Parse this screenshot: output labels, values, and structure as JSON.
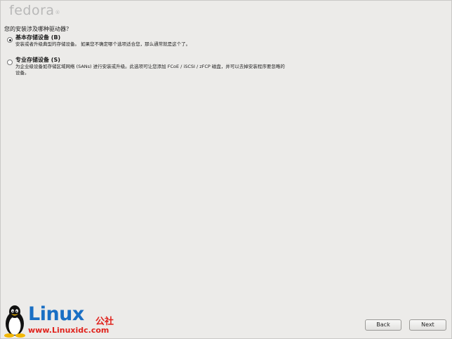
{
  "header": {
    "brand": "fedora",
    "brand_mark": "®"
  },
  "prompt": {
    "question": "您的安装涉及哪种驱动器？"
  },
  "options": [
    {
      "title": "基本存储设备 (B)",
      "description": "安装或者升级典型的存储设备。 如果您不确定哪个选项适合您，那么通常就是这个了。",
      "selected": true
    },
    {
      "title": "专业存储设备 (S)",
      "description": "为企业级设备如存储区域网络 (SANs) 进行安装或升级。此选项可让您添加 FCoE / iSCSI / zFCP 磁盘，并可以去掉安装程序要忽略的设备。",
      "selected": false
    }
  ],
  "buttons": {
    "back": "Back",
    "next": "Next"
  },
  "watermark": {
    "title": "Linux",
    "title_cn": "公社",
    "url": "www.Linuxidc.com"
  }
}
